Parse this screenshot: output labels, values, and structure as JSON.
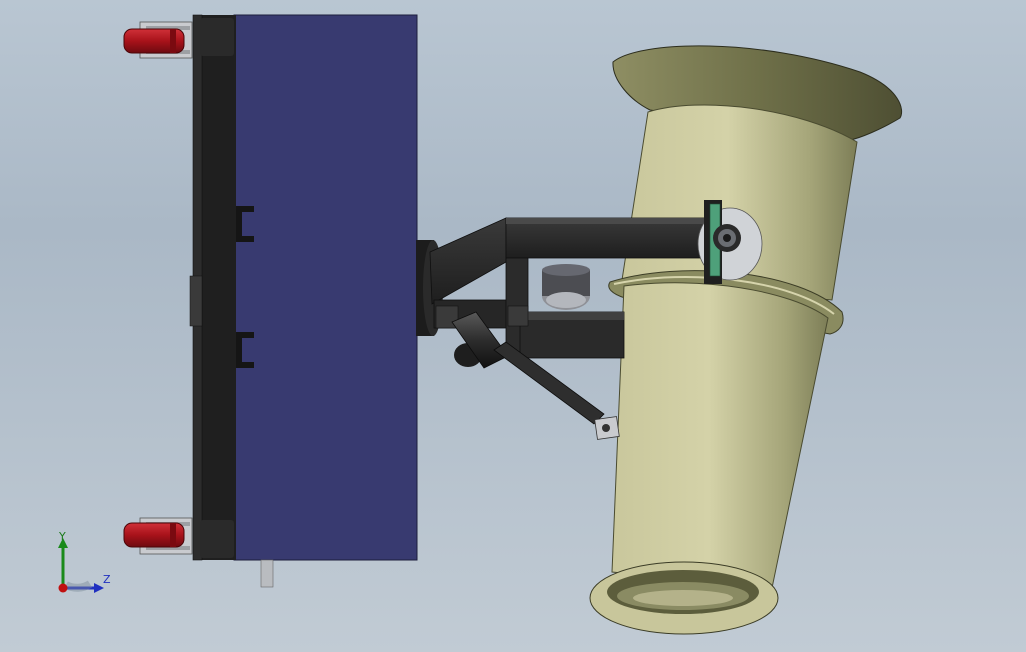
{
  "viewport": {
    "background_top": "#b9c6d2",
    "background_bottom": "#c1cbd4"
  },
  "colors": {
    "panel_blue": "#383a70",
    "frame_black": "#1f1f1f",
    "cone_olive": "#bdbb8e",
    "cone_shadow": "#75764f",
    "bracket_black": "#2a2a2a",
    "wheel_red": "#b4141c",
    "bearing_green": "#4ea07a"
  },
  "triad": {
    "y_label": "Y",
    "z_label": "Z",
    "y_color": "#1a8a1a",
    "z_color": "#2030c0",
    "origin_color": "#c01010"
  },
  "icons": [
    "reference-triad-icon"
  ]
}
